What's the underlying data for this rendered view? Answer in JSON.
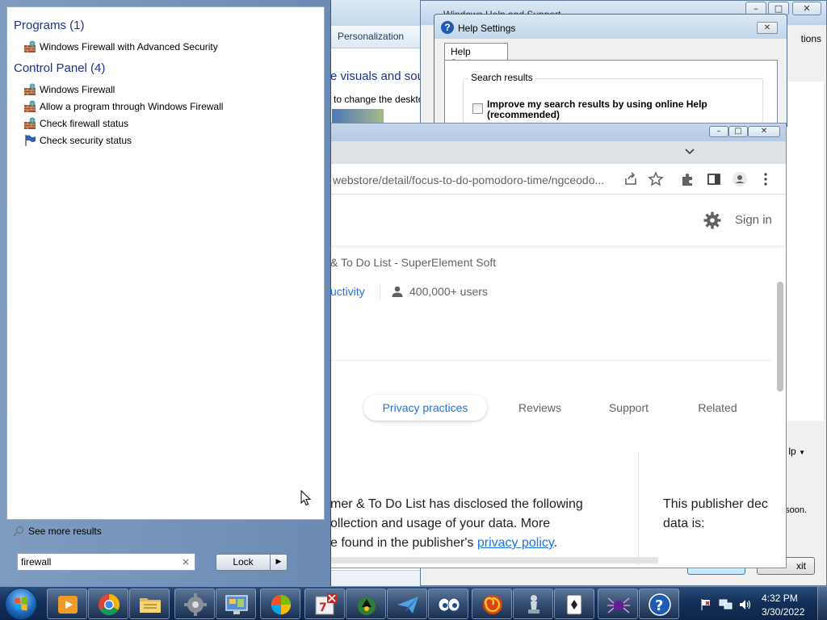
{
  "background_personalization": {
    "tab_label": "Personalization",
    "heading": "e visuals and sou",
    "subtext": "to change the deskto"
  },
  "background_help": {
    "title": "Windows Help and Support",
    "options_label": "tions",
    "help_label": "lp",
    "help_arrow": "▼",
    "status_text": "soon.",
    "exit_label": "xit"
  },
  "help_settings": {
    "title": "Help Settings",
    "tab_label": "Help Settings",
    "group_label": "Search results",
    "checkbox_label": "Improve my search results by using online Help (recommended)",
    "checkbox_checked": false
  },
  "chrome": {
    "url": "webstore/detail/focus-to-do-pomodoro-time/ngceodo...",
    "sign_in_label": "Sign in",
    "extension_name": "& To Do List - SuperElement Soft",
    "category": "uctivity",
    "users": "400,000+ users",
    "tabs": {
      "privacy": "Privacy practices",
      "reviews": "Reviews",
      "support": "Support",
      "related": "Related"
    },
    "privacy_line1": "mer & To Do List has disclosed the following",
    "privacy_line2": "ollection and usage of your data. More",
    "privacy_line3_prefix": "e found in the publisher's ",
    "privacy_link": "privacy policy",
    "privacy_line3_suffix": ".",
    "publisher_line1": "This publisher dec",
    "publisher_line2": "data is:"
  },
  "start_menu": {
    "programs_heading": "Programs (1)",
    "programs": [
      {
        "label": "Windows Firewall with Advanced Security",
        "icon": "firewall-icon"
      }
    ],
    "control_panel_heading": "Control Panel (4)",
    "control_panel": [
      {
        "label": "Windows Firewall",
        "icon": "firewall-icon"
      },
      {
        "label": "Allow a program through Windows Firewall",
        "icon": "firewall-icon"
      },
      {
        "label": "Check firewall status",
        "icon": "firewall-icon"
      },
      {
        "label": "Check security status",
        "icon": "flag-icon"
      }
    ],
    "see_more": "See more results",
    "search_value": "firewall",
    "clear_symbol": "×",
    "lock_label": "Lock",
    "lock_arrow": "▶"
  },
  "taskbar": {
    "apps": [
      "media-player-icon",
      "chrome-icon",
      "file-explorer-icon",
      "settings-gear-icon",
      "control-panel-icon",
      "windows-update-icon",
      "calendar-icon",
      "solitaire-game-icon",
      "paper-plane-icon",
      "eyes-icon",
      "swirl-game-icon",
      "chess-icon",
      "cards-icon",
      "spider-solitaire-icon",
      "help-icon"
    ],
    "time": "4:32 PM",
    "date": "3/30/2022"
  }
}
